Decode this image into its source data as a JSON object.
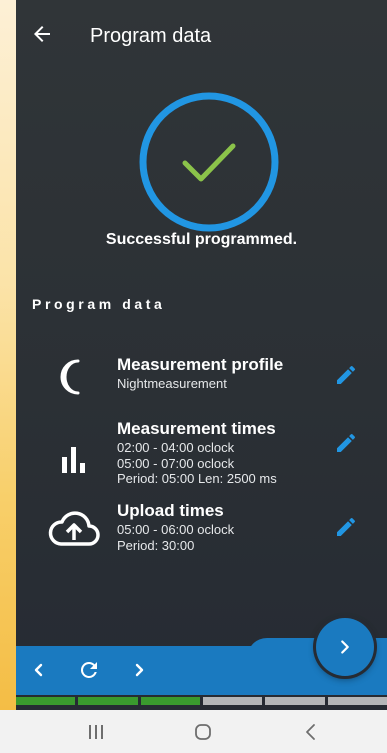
{
  "header": {
    "title": "Program data",
    "back_icon": "arrow-left-icon"
  },
  "status": {
    "text": "Successful programmed.",
    "icon": "checkmark-icon",
    "ring_color": "#2196e3",
    "check_color": "#8bc34a"
  },
  "section": {
    "title": "Program data"
  },
  "items": [
    {
      "icon": "moon-icon",
      "title": "Measurement profile",
      "lines": [
        "Nightmeasurement"
      ],
      "edit_icon": "pencil-icon"
    },
    {
      "icon": "bar-chart-icon",
      "title": "Measurement times",
      "lines": [
        "02:00 - 04:00 oclock",
        "05:00 - 07:00 oclock",
        "Period: 05:00 Len: 2500 ms"
      ],
      "edit_icon": "pencil-icon"
    },
    {
      "icon": "cloud-upload-icon",
      "title": "Upload times",
      "lines": [
        "05:00 - 06:00 oclock",
        "Period: 30:00"
      ],
      "edit_icon": "pencil-icon"
    }
  ],
  "bottom_nav": {
    "prev_icon": "chevron-left-icon",
    "refresh_icon": "refresh-icon",
    "next_icon": "chevron-right-icon",
    "fab_icon": "chevron-right-icon"
  },
  "progress": {
    "completed_steps": 3,
    "total_steps": 6,
    "done_color": "#3a9a2e",
    "todo_color": "#b4b6b8"
  },
  "system_nav": {
    "recents_icon": "recents-icon",
    "home_icon": "home-icon",
    "back_icon": "back-icon"
  },
  "colors": {
    "accent": "#2196e3",
    "bar": "#1a7ac0",
    "edit": "#2196e3"
  }
}
